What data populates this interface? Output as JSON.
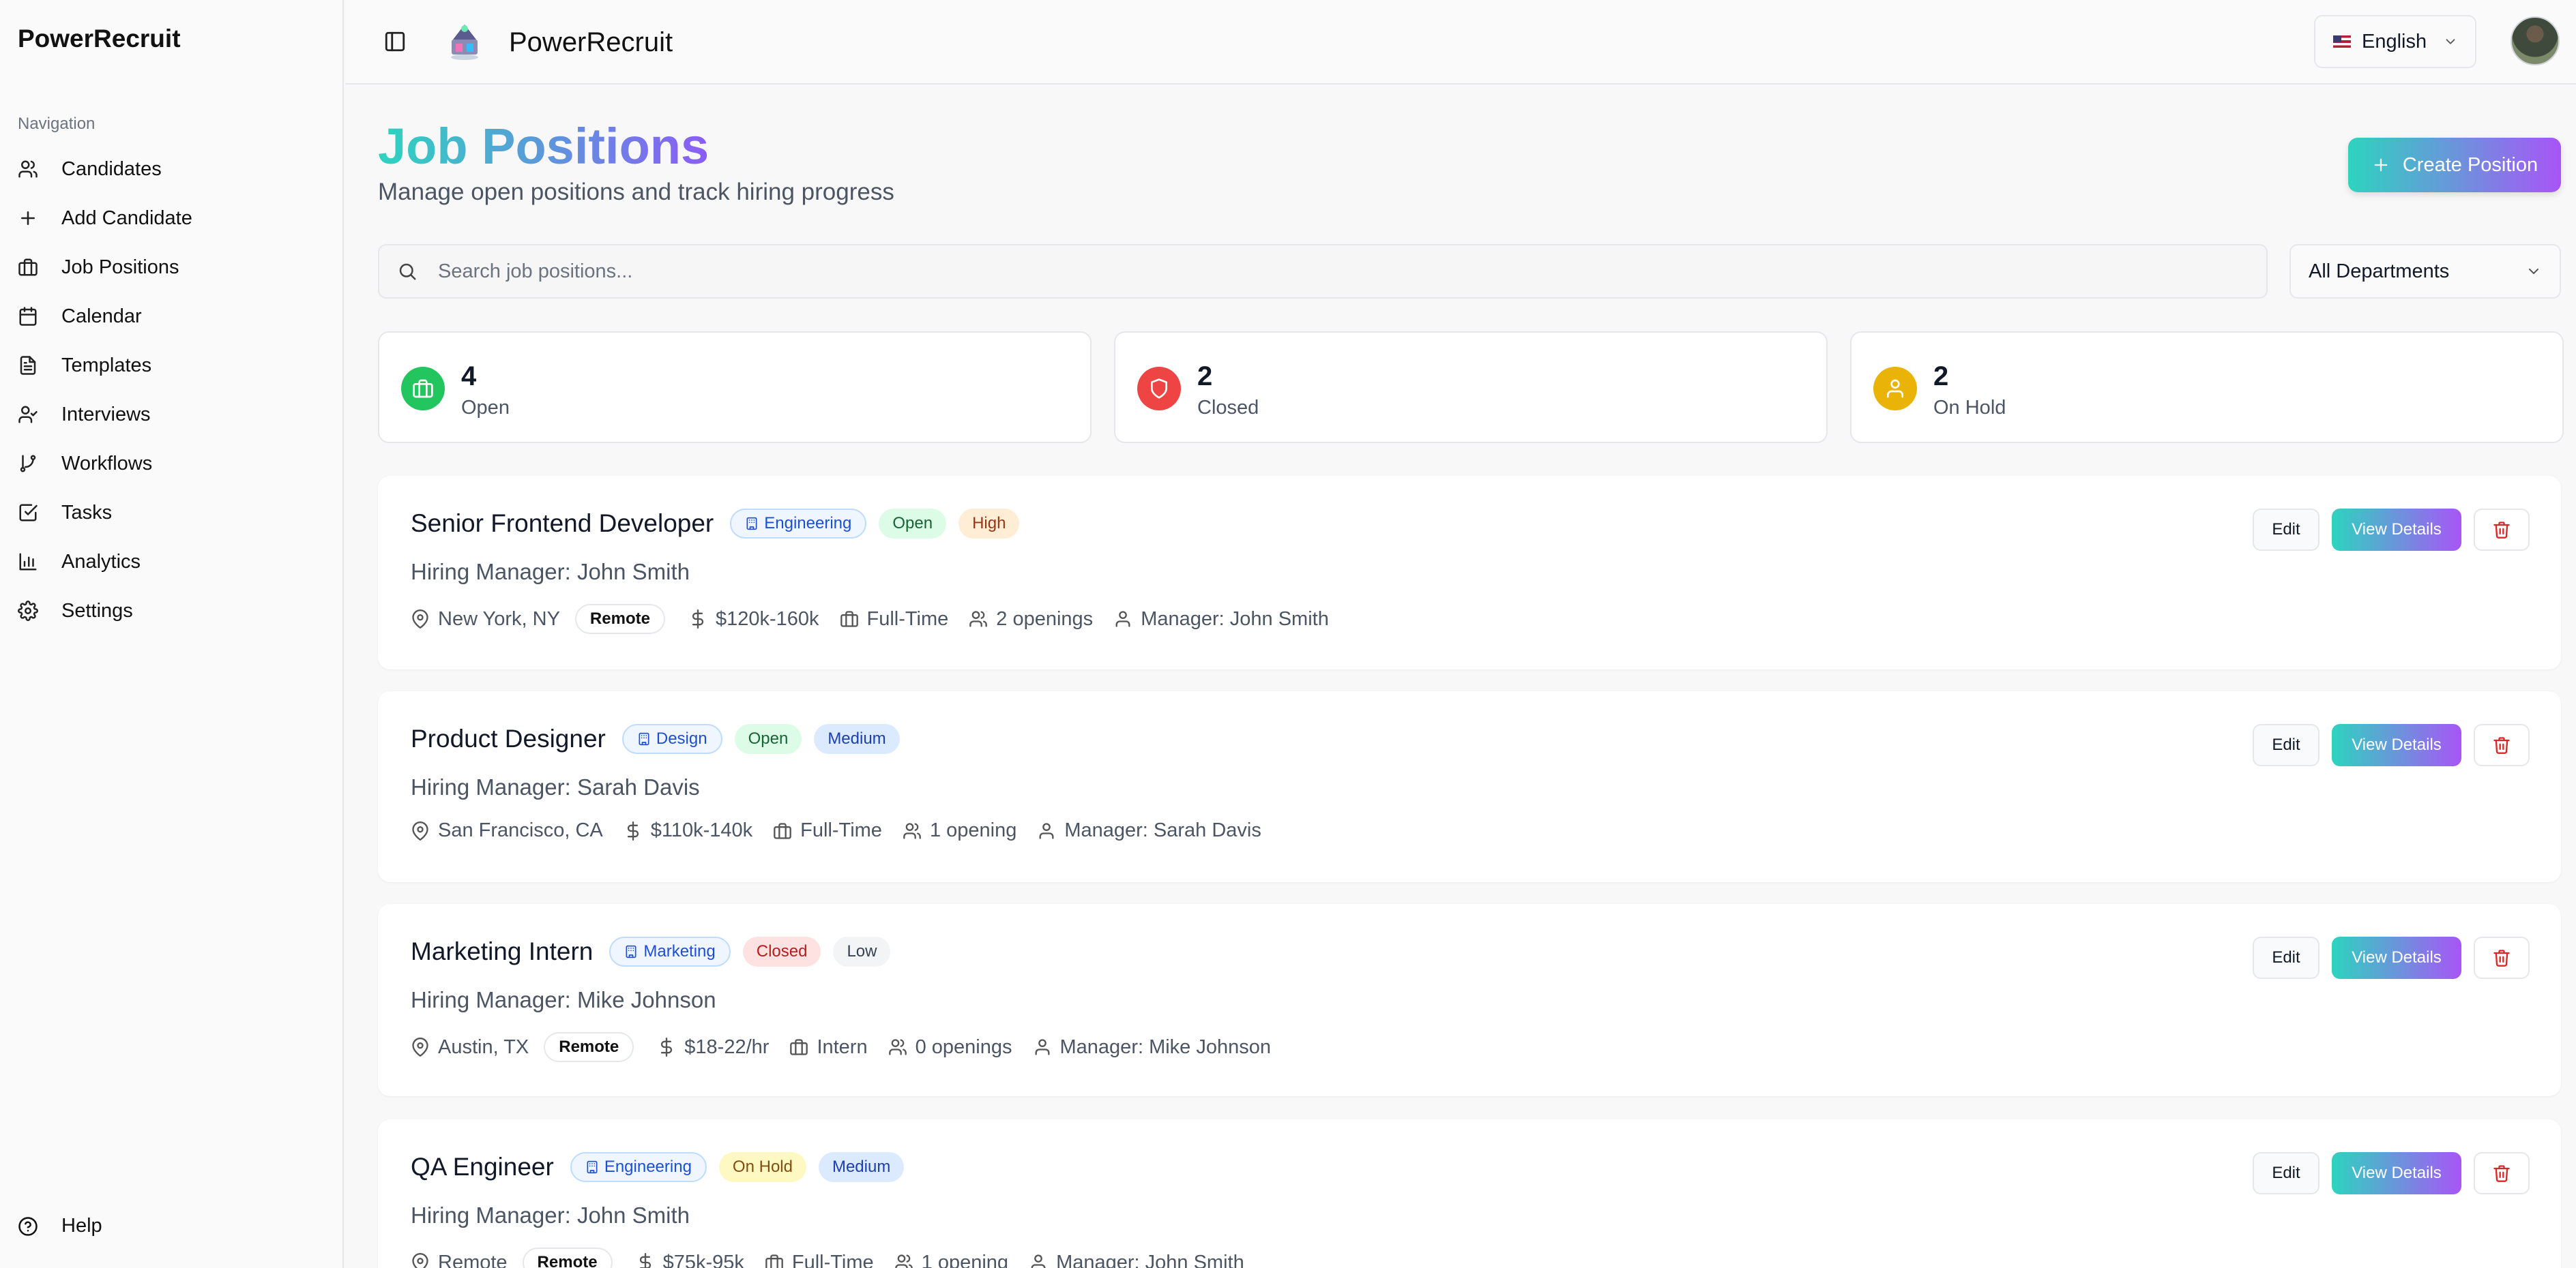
{
  "sidebar": {
    "brand": "PowerRecruit",
    "nav_heading": "Navigation",
    "items": [
      {
        "label": "Candidates",
        "icon": "users-icon"
      },
      {
        "label": "Add Candidate",
        "icon": "plus-icon"
      },
      {
        "label": "Job Positions",
        "icon": "briefcase-icon"
      },
      {
        "label": "Calendar",
        "icon": "calendar-icon"
      },
      {
        "label": "Templates",
        "icon": "file-text-icon"
      },
      {
        "label": "Interviews",
        "icon": "user-check-icon"
      },
      {
        "label": "Workflows",
        "icon": "git-branch-icon"
      },
      {
        "label": "Tasks",
        "icon": "check-square-icon"
      },
      {
        "label": "Analytics",
        "icon": "bar-chart-icon"
      },
      {
        "label": "Settings",
        "icon": "gear-icon"
      }
    ],
    "help_label": "Help"
  },
  "header": {
    "app_title": "PowerRecruit",
    "language": "English"
  },
  "main": {
    "title": "Job Positions",
    "subtitle": "Manage open positions and track hiring progress",
    "create_label": "Create Position",
    "search_placeholder": "Search job positions...",
    "department_filter": "All Departments",
    "stats": [
      {
        "value": "4",
        "label": "Open",
        "color": "#22c55e"
      },
      {
        "value": "2",
        "label": "Closed",
        "color": "#ef4444"
      },
      {
        "value": "2",
        "label": "On Hold",
        "color": "#eab308"
      }
    ],
    "jobs": [
      {
        "title": "Senior Frontend Developer",
        "department": "Engineering",
        "status": "Open",
        "priority": "High",
        "manager": "Hiring Manager: John Smith",
        "location": "New York, NY",
        "remote": "Remote",
        "salary": "$120k-160k",
        "type": "Full-Time",
        "openings": "2 openings",
        "manager_short": "Manager: John Smith"
      },
      {
        "title": "Product Designer",
        "department": "Design",
        "status": "Open",
        "priority": "Medium",
        "manager": "Hiring Manager: Sarah Davis",
        "location": "San Francisco, CA",
        "remote": "",
        "salary": "$110k-140k",
        "type": "Full-Time",
        "openings": "1 opening",
        "manager_short": "Manager: Sarah Davis"
      },
      {
        "title": "Marketing Intern",
        "department": "Marketing",
        "status": "Closed",
        "priority": "Low",
        "manager": "Hiring Manager: Mike Johnson",
        "location": "Austin, TX",
        "remote": "Remote",
        "salary": "$18-22/hr",
        "type": "Intern",
        "openings": "0 openings",
        "manager_short": "Manager: Mike Johnson"
      },
      {
        "title": "QA Engineer",
        "department": "Engineering",
        "status": "On Hold",
        "priority": "Medium",
        "manager": "Hiring Manager: John Smith",
        "location": "Remote",
        "remote": "Remote",
        "salary": "$75k-95k",
        "type": "Full-Time",
        "openings": "1 opening",
        "manager_short": "Manager: John Smith"
      }
    ],
    "edit_label": "Edit",
    "view_label": "View Details"
  },
  "colors": {
    "accent_start": "#2dd4bf",
    "accent_end": "#a855f7",
    "delete": "#dc2626"
  }
}
